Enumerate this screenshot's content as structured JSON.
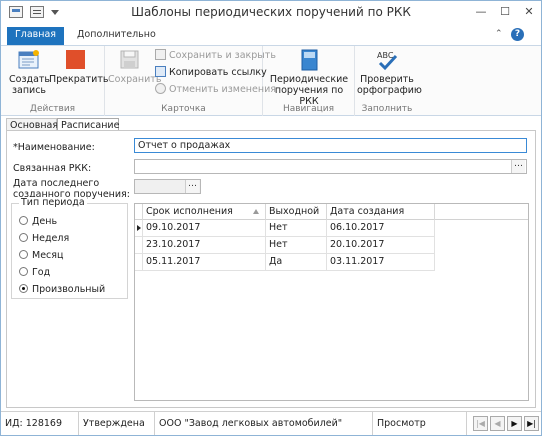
{
  "window": {
    "title": "Шаблоны периодических поручений по РКК",
    "min_glyph": "—",
    "max_glyph": "☐",
    "close_glyph": "✕"
  },
  "ribbon": {
    "tabs": [
      "Главная",
      "Дополнительно"
    ],
    "groups": {
      "actions": {
        "caption": "Действия",
        "create": "Создать запись",
        "stop": "Прекратить"
      },
      "card": {
        "caption": "Карточка",
        "save": "Сохранить",
        "save_close": "Сохранить и закрыть",
        "copy_link": "Копировать ссылку",
        "undo": "Отменить изменения"
      },
      "navigation": {
        "caption": "Навигация",
        "periodic": "Периодические поручения по РКК"
      },
      "fill": {
        "caption": "Заполнить",
        "spell": "Проверить орфографию",
        "abc": "ABC"
      }
    }
  },
  "form_tabs": [
    "Основная",
    "Расписание"
  ],
  "form": {
    "name_label": "*Наименование:",
    "name_value": "Отчет о продажах",
    "rkk_label": "Связанная РКК:",
    "rkk_value": "",
    "lastdate_label_1": "Дата последнего",
    "lastdate_label_2": "созданного поручения:",
    "lastdate_value": "",
    "ellipsis": "…"
  },
  "period": {
    "legend": "Тип периода",
    "options": [
      "День",
      "Неделя",
      "Месяц",
      "Год",
      "Произвольный"
    ],
    "selected": "Произвольный"
  },
  "grid": {
    "columns": [
      "Срок исполнения",
      "Выходной",
      "Дата создания"
    ],
    "rows": [
      [
        "09.10.2017",
        "Нет",
        "06.10.2017"
      ],
      [
        "23.10.2017",
        "Нет",
        "20.10.2017"
      ],
      [
        "05.11.2017",
        "Да",
        "03.11.2017"
      ]
    ]
  },
  "statusbar": {
    "id": "ИД: 128169",
    "status": "Утверждена",
    "org": "ООО \"Завод легковых автомобилей\"",
    "mode": "Просмотр"
  },
  "colors": {
    "accent": "#1e73be",
    "stop": "#e04f2a"
  }
}
